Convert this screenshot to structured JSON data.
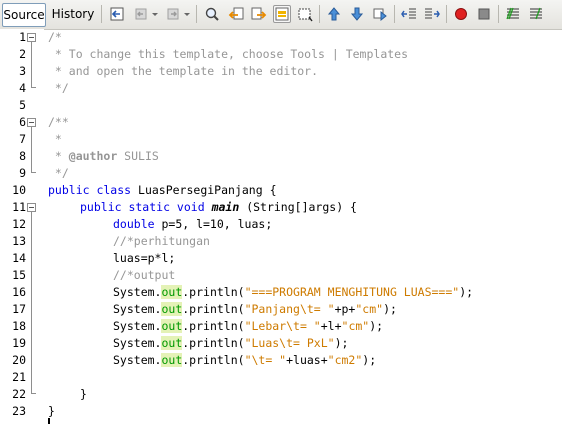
{
  "tabs": {
    "source": "Source",
    "history": "History"
  },
  "toolbar": {
    "buttons": [
      "last-edit-icon",
      "back-icon",
      "forward-icon",
      "find-selection-icon",
      "find-previous-icon",
      "find-next-icon",
      "toggle-highlight-icon",
      "rect-selection-icon",
      "previous-bookmark-icon",
      "next-bookmark-icon",
      "toggle-bookmark-icon",
      "shift-left-icon",
      "shift-right-icon",
      "start-macro-icon",
      "stop-macro-icon",
      "comment-icon",
      "uncomment-icon"
    ]
  },
  "editor": {
    "line_numbers": [
      "1",
      "2",
      "3",
      "4",
      "5",
      "6",
      "7",
      "8",
      "9",
      "10",
      "11",
      "12",
      "13",
      "14",
      "15",
      "16",
      "17",
      "18",
      "19",
      "20",
      "21",
      "22",
      "23"
    ],
    "lines": {
      "l1": "/*",
      "l2": " * To change this template, choose Tools | Templates",
      "l3": " * and open the template in the editor.",
      "l4": " */",
      "l6": "/**",
      "l7": " *",
      "l8_pre": " * ",
      "l8_tag": "@author",
      "l8_name": " SULIS",
      "l9": " */",
      "l10_kw": "public class",
      "l10_rest": " LuasPersegiPanjang {",
      "l11_kw": "public static void",
      "l11_method": "main",
      "l11_rest": " (String[]args) {",
      "l12_kw": "double",
      "l12_rest": " p=5, l=10, luas;",
      "l13": "//*perhitungan",
      "l14": "luas=p*l;",
      "l15": "//*output",
      "sys": "System.",
      "out": "out",
      "println": ".println(",
      "l16_str": "\"===PROGRAM MENGHITUNG LUAS===\"",
      "l16_end": ");",
      "l17_str1": "\"Panjang\\t= \"",
      "l17_mid": "+p+",
      "l17_str2": "\"cm\"",
      "l17_end": ");",
      "l18_str1": "\"Lebar\\t= \"",
      "l18_mid": "+l+",
      "l18_str2": "\"cm\"",
      "l18_end": ");",
      "l19_str": "\"Luas\\t= PxL\"",
      "l19_end": ");",
      "l20_str1": "\"\\t= \"",
      "l20_mid": "+luas+",
      "l20_str2": "\"cm2\"",
      "l20_end": ");",
      "l22": "}",
      "l23": "}"
    }
  }
}
